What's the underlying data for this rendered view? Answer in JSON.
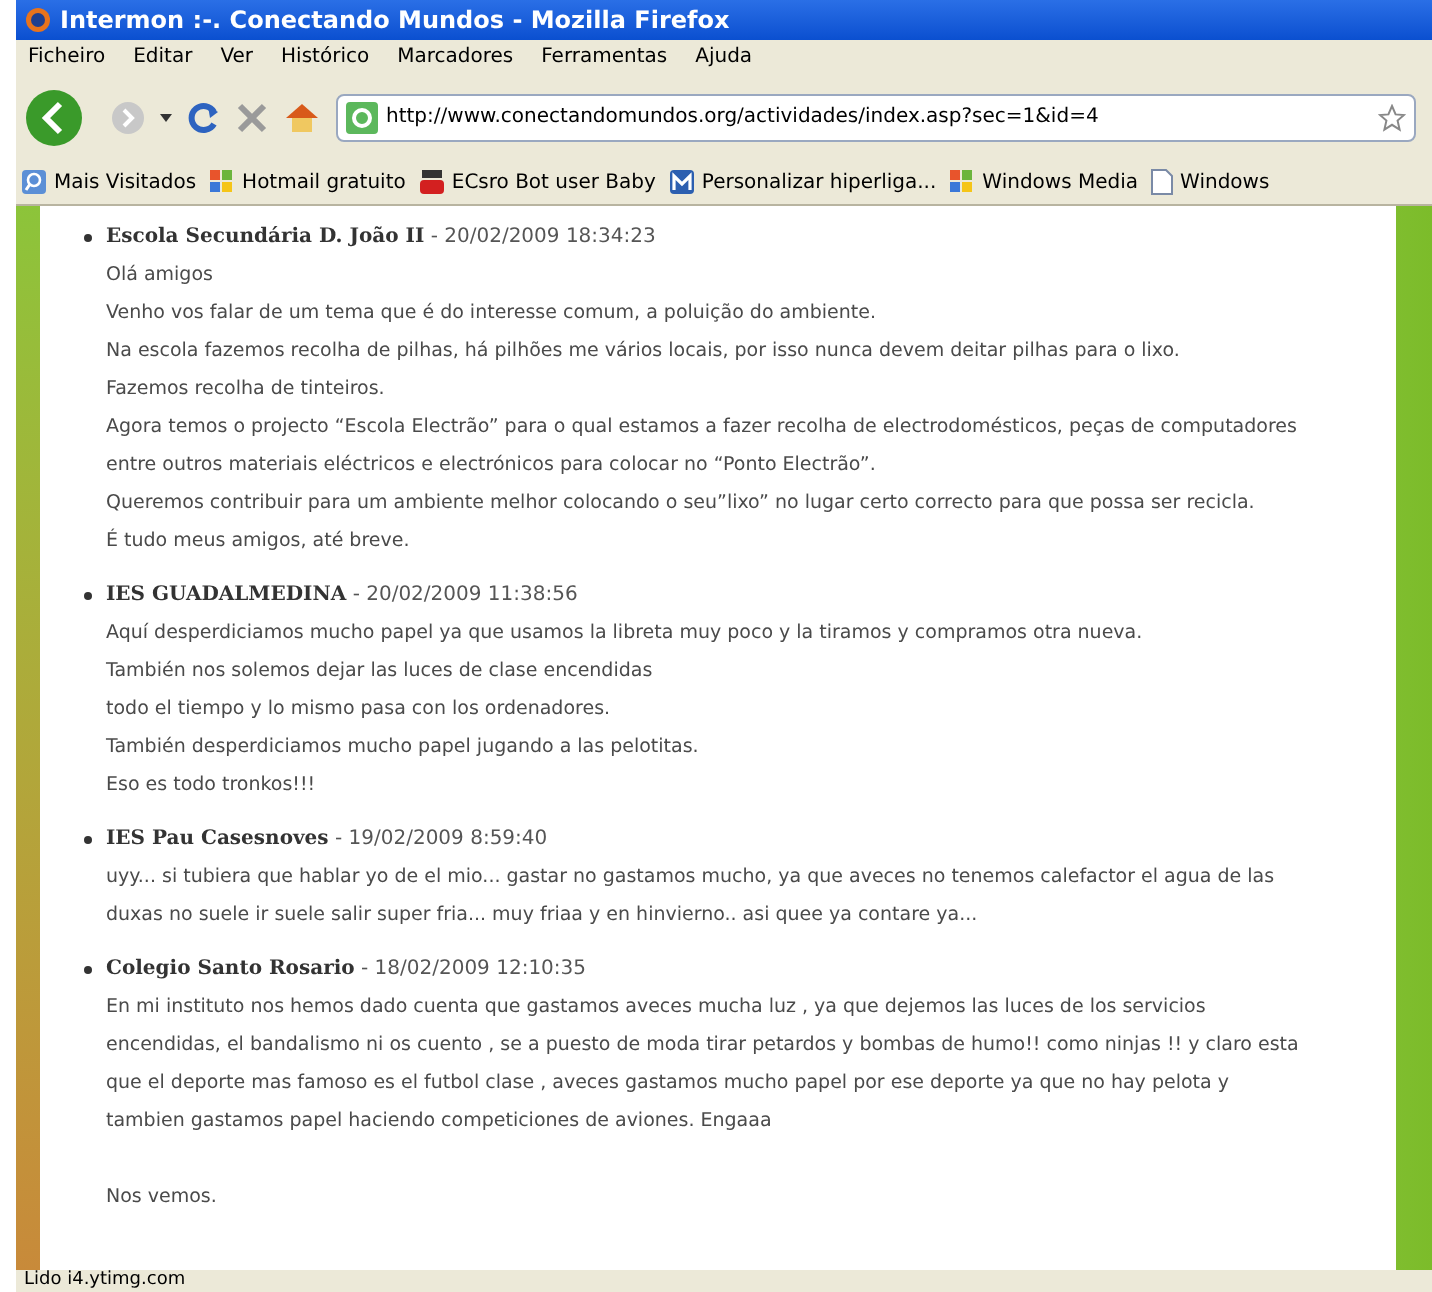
{
  "window": {
    "title": "Intermon :-. Conectando Mundos - Mozilla Firefox"
  },
  "menu": [
    "Ficheiro",
    "Editar",
    "Ver",
    "Histórico",
    "Marcadores",
    "Ferramentas",
    "Ajuda"
  ],
  "address_bar": {
    "value": "http://www.conectandomundos.org/actividades/index.asp?sec=1&id=4"
  },
  "bookmarks": [
    {
      "label": "Mais Visitados",
      "kind": "search"
    },
    {
      "label": "Hotmail gratuito",
      "kind": "windows"
    },
    {
      "label": "ECsro Bot user Baby",
      "kind": "video"
    },
    {
      "label": "Personalizar hiperliga...",
      "kind": "m"
    },
    {
      "label": "Windows Media",
      "kind": "windows"
    },
    {
      "label": "Windows",
      "kind": "page"
    }
  ],
  "posts": [
    {
      "author": "Escola Secundária D. João II",
      "date": "- 20/02/2009 18:34:23",
      "paragraphs": [
        "Olá amigos",
        "Venho vos falar de um tema que é do interesse comum, a poluição do ambiente.",
        "Na escola fazemos recolha de pilhas, há pilhões me vários locais, por isso nunca devem deitar pilhas para o lixo.",
        "Fazemos recolha de tinteiros.",
        "Agora temos o projecto “Escola Electrão” para o qual estamos a fazer recolha de electrodomésticos, peças de computadores entre outros materiais eléctricos e electrónicos para colocar no “Ponto Electrão”.",
        "Queremos contribuir para um ambiente melhor colocando o seu”lixo” no lugar certo correcto para que possa ser recicla.",
        "É tudo meus amigos, até breve."
      ]
    },
    {
      "author": "IES GUADALMEDINA",
      "date": "- 20/02/2009 11:38:56",
      "paragraphs": [
        "Aquí desperdiciamos mucho papel ya que usamos la libreta muy poco y la tiramos y compramos otra nueva.",
        "También nos solemos dejar las luces de clase encendidas",
        "todo el tiempo y lo mismo pasa con los ordenadores.",
        "También desperdiciamos mucho papel jugando a las pelotitas.",
        "Eso es todo tronkos!!!"
      ]
    },
    {
      "author": "IES Pau Casesnoves",
      "date": "- 19/02/2009 8:59:40",
      "paragraphs": [
        "uyy... si tubiera que hablar yo de el mio... gastar no gastamos mucho, ya que aveces no tenemos calefactor el agua de las duxas no suele ir suele salir super fria... muy friaa y en hinvierno.. asi quee ya contare ya..."
      ]
    },
    {
      "author": "Colegio Santo Rosario",
      "date": "- 18/02/2009 12:10:35",
      "paragraphs": [
        "En mi instituto nos hemos dado cuenta que gastamos aveces mucha luz , ya que dejemos las luces de los servicios encendidas, el bandalismo ni os cuento , se a puesto de moda tirar petardos y bombas de humo!! como ninjas !! y claro esta que el deporte mas famoso es el futbol clase , aveces gastamos mucho papel por ese deporte ya que no hay pelota y tambien gastamos papel haciendo competiciones de aviones. Engaaa"
      ],
      "closing": "Nos vemos."
    }
  ],
  "status_bar": "Lido i4.ytimg.com"
}
